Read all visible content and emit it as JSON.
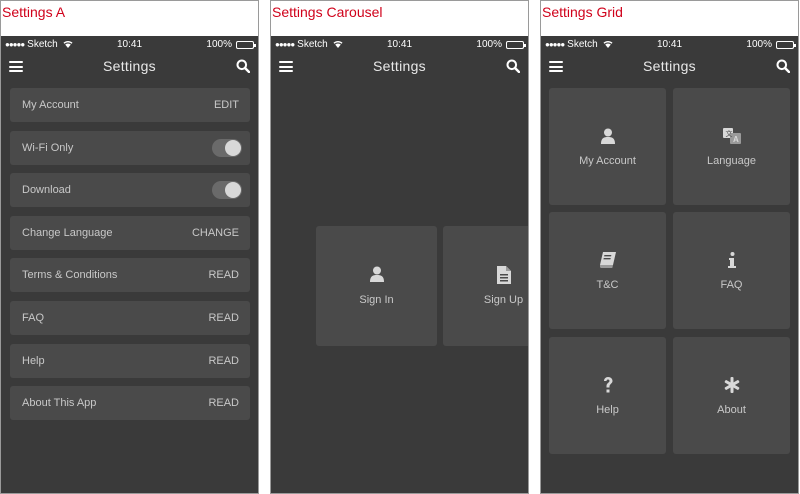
{
  "artboards": {
    "settings_a": {
      "title": "Settings A"
    },
    "settings_carousel": {
      "title": "Settings Carousel"
    },
    "settings_grid": {
      "title": "Settings Grid"
    }
  },
  "statusbar": {
    "carrier": "Sketch",
    "signal_dots": "●●●●●",
    "time": "10:41",
    "battery": "100%",
    "battery_level": 1.0
  },
  "navbar": {
    "title": "Settings",
    "menu_icon": "hamburger-icon",
    "search_icon": "search-icon"
  },
  "settings_list": [
    {
      "label": "My Account",
      "action": "EDIT"
    },
    {
      "label": "Wi-Fi Only",
      "toggle": true
    },
    {
      "label": "Download",
      "toggle": true
    },
    {
      "label": "Change Language",
      "action": "CHANGE"
    },
    {
      "label": "Terms & Conditions",
      "action": "READ"
    },
    {
      "label": "FAQ",
      "action": "READ"
    },
    {
      "label": "Help",
      "action": "READ"
    },
    {
      "label": "About This App",
      "action": "READ"
    }
  ],
  "carousel": [
    {
      "label": "Sign In",
      "icon": "user-icon"
    },
    {
      "label": "Sign Up",
      "icon": "document-icon"
    }
  ],
  "grid": [
    {
      "label": "My Account",
      "icon": "user-icon"
    },
    {
      "label": "Language",
      "icon": "translate-icon"
    },
    {
      "label": "T&C",
      "icon": "book-icon"
    },
    {
      "label": "FAQ",
      "icon": "info-icon"
    },
    {
      "label": "Help",
      "icon": "question-icon"
    },
    {
      "label": "About",
      "icon": "asterisk-icon"
    }
  ],
  "colors": {
    "title_red": "#d0021b",
    "phone_bg": "#3a3a3a",
    "card_bg": "#4a4a4a",
    "text_light": "#c8c8c8"
  }
}
